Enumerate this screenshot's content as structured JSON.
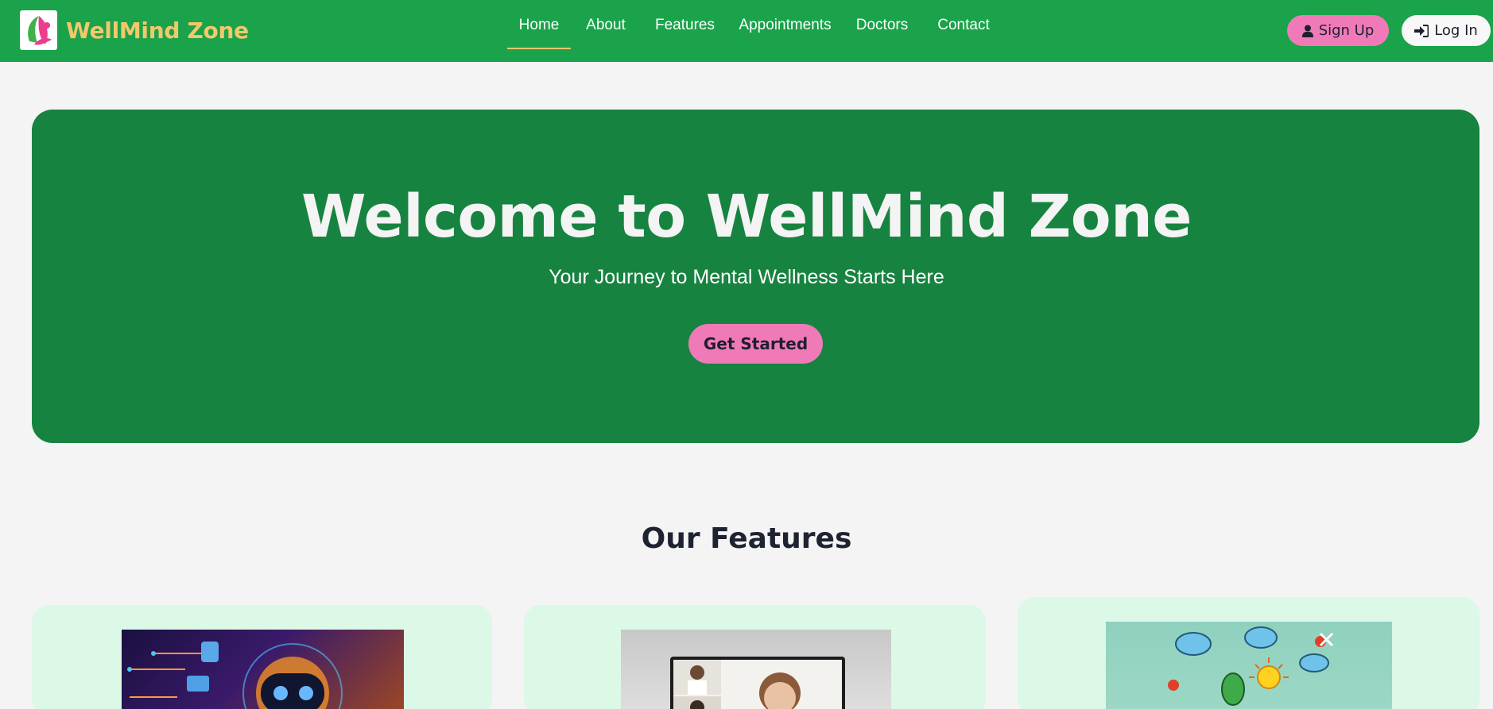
{
  "brand": {
    "name": "WellMind Zone",
    "logo_icon": "leaf-face-logo-icon"
  },
  "nav": {
    "links": [
      {
        "label": "Home",
        "active": true
      },
      {
        "label": "About",
        "active": false
      },
      {
        "label": "Features",
        "active": false
      },
      {
        "label": "Appointments",
        "active": false
      },
      {
        "label": "Doctors",
        "active": false
      },
      {
        "label": "Contact",
        "active": false
      }
    ],
    "signup_label": "Sign Up",
    "signup_icon": "user-icon",
    "login_label": "Log In",
    "login_icon": "sign-in-icon"
  },
  "hero": {
    "title": "Welcome to WellMind Zone",
    "subtitle": "Your Journey to Mental Wellness Starts Here",
    "cta_label": "Get Started"
  },
  "features": {
    "title": "Our Features",
    "cards": [
      {
        "image_icon": "ai-robot-chatbot-image"
      },
      {
        "image_icon": "video-consultation-image"
      },
      {
        "image_icon": "creative-doodle-lightbulb-image"
      }
    ]
  },
  "colors": {
    "navbar": "#1aa34a",
    "hero": "#178340",
    "accent_pink": "#f07ab8",
    "brand_gold": "#f2c86b",
    "card_bg": "#dcf8e6",
    "page_bg": "#f4f4f4"
  }
}
